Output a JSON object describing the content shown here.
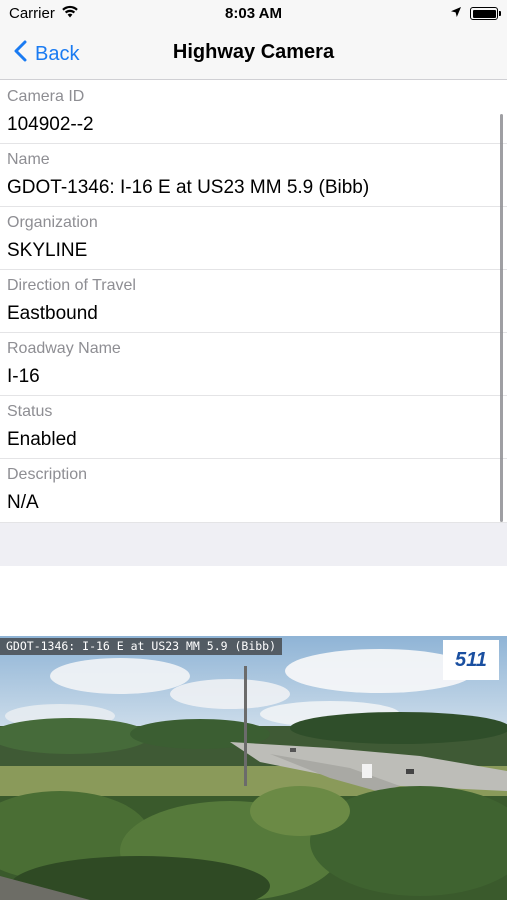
{
  "status_bar": {
    "carrier": "Carrier",
    "time": "8:03 AM"
  },
  "nav": {
    "back_label": "Back",
    "title": "Highway Camera"
  },
  "details": [
    {
      "label": "Camera ID",
      "value": "104902--2"
    },
    {
      "label": "Name",
      "value": "GDOT-1346: I-16 E at US23 MM 5.9 (Bibb)"
    },
    {
      "label": "Organization",
      "value": "SKYLINE"
    },
    {
      "label": "Direction of Travel",
      "value": "Eastbound"
    },
    {
      "label": "Roadway Name",
      "value": "I-16"
    },
    {
      "label": "Status",
      "value": "Enabled"
    },
    {
      "label": "Description",
      "value": "N/A"
    }
  ],
  "camera": {
    "caption": "GDOT-1346: I-16 E at US23 MM 5.9 (Bibb)",
    "logo_text": "511"
  },
  "colors": {
    "accent": "#1a7bf2",
    "label_gray": "#8e8e93",
    "separator": "#e4e4e6"
  }
}
